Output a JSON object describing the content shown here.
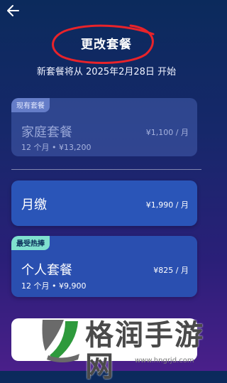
{
  "header": {
    "back_icon": "arrow-left-icon",
    "title": "更改套餐",
    "subtitle": "新套餐将从 2025年2月28日 开始"
  },
  "plans": {
    "current": {
      "badge": "现有套餐",
      "name": "家庭套餐",
      "price": "¥1,100 / 月",
      "meta": "12 个月 • ¥13,200"
    },
    "monthly": {
      "name": "月缴",
      "price": "¥1,990 / 月"
    },
    "personal": {
      "badge": "最受热捧",
      "name": "个人套餐",
      "price": "¥825 / 月",
      "meta": "12 个月 • ¥9,900"
    }
  },
  "watermark": {
    "text": "格润手游网",
    "url": "www.hngrjd.com"
  },
  "colors": {
    "annotation_circle": "#e8232a",
    "hot_badge": "#7fe0cf",
    "card_blue": "#2a55b8"
  }
}
